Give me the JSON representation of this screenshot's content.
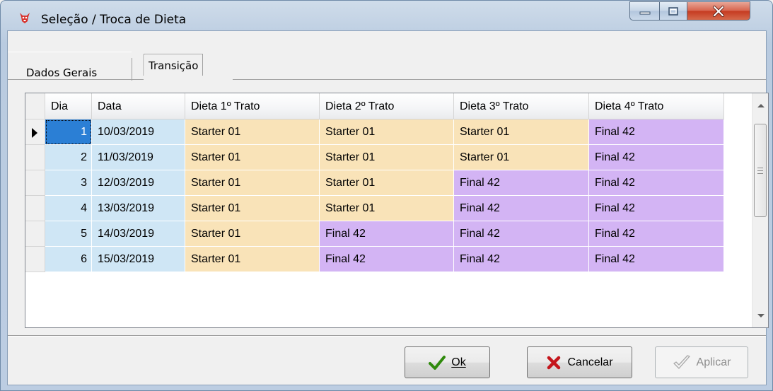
{
  "window": {
    "title": "Seleção / Troca de Dieta"
  },
  "tabs": [
    {
      "label": "Dados Gerais"
    },
    {
      "label": "Transição"
    }
  ],
  "grid": {
    "columns": [
      "Dia",
      "Data",
      "Dieta 1º Trato",
      "Dieta 2º Trato",
      "Dieta 3º Trato",
      "Dieta 4º Trato"
    ],
    "rows": [
      {
        "dia": "1",
        "data": "10/03/2019",
        "d1": "Starter 01",
        "d2": "Starter 01",
        "d3": "Starter 01",
        "d4": "Final 42"
      },
      {
        "dia": "2",
        "data": "11/03/2019",
        "d1": "Starter 01",
        "d2": "Starter 01",
        "d3": "Starter 01",
        "d4": "Final 42"
      },
      {
        "dia": "3",
        "data": "12/03/2019",
        "d1": "Starter 01",
        "d2": "Starter 01",
        "d3": "Final 42",
        "d4": "Final 42"
      },
      {
        "dia": "4",
        "data": "13/03/2019",
        "d1": "Starter 01",
        "d2": "Starter 01",
        "d3": "Final 42",
        "d4": "Final 42"
      },
      {
        "dia": "5",
        "data": "14/03/2019",
        "d1": "Starter 01",
        "d2": "Final 42",
        "d3": "Final 42",
        "d4": "Final 42"
      },
      {
        "dia": "6",
        "data": "15/03/2019",
        "d1": "Starter 01",
        "d2": "Final 42",
        "d3": "Final 42",
        "d4": "Final 42"
      }
    ],
    "colors": {
      "starter": "#f9e3b8",
      "final": "#d3b4f4",
      "key_columns": "#cfe6f5",
      "selected": "#2b7fd5"
    }
  },
  "buttons": {
    "ok": {
      "label": "Ok",
      "icon": "check-icon"
    },
    "cancel": {
      "label": "Cancelar",
      "icon": "x-icon"
    },
    "apply": {
      "label": "Aplicar",
      "icon": "check-outline-icon",
      "disabled": true
    }
  }
}
